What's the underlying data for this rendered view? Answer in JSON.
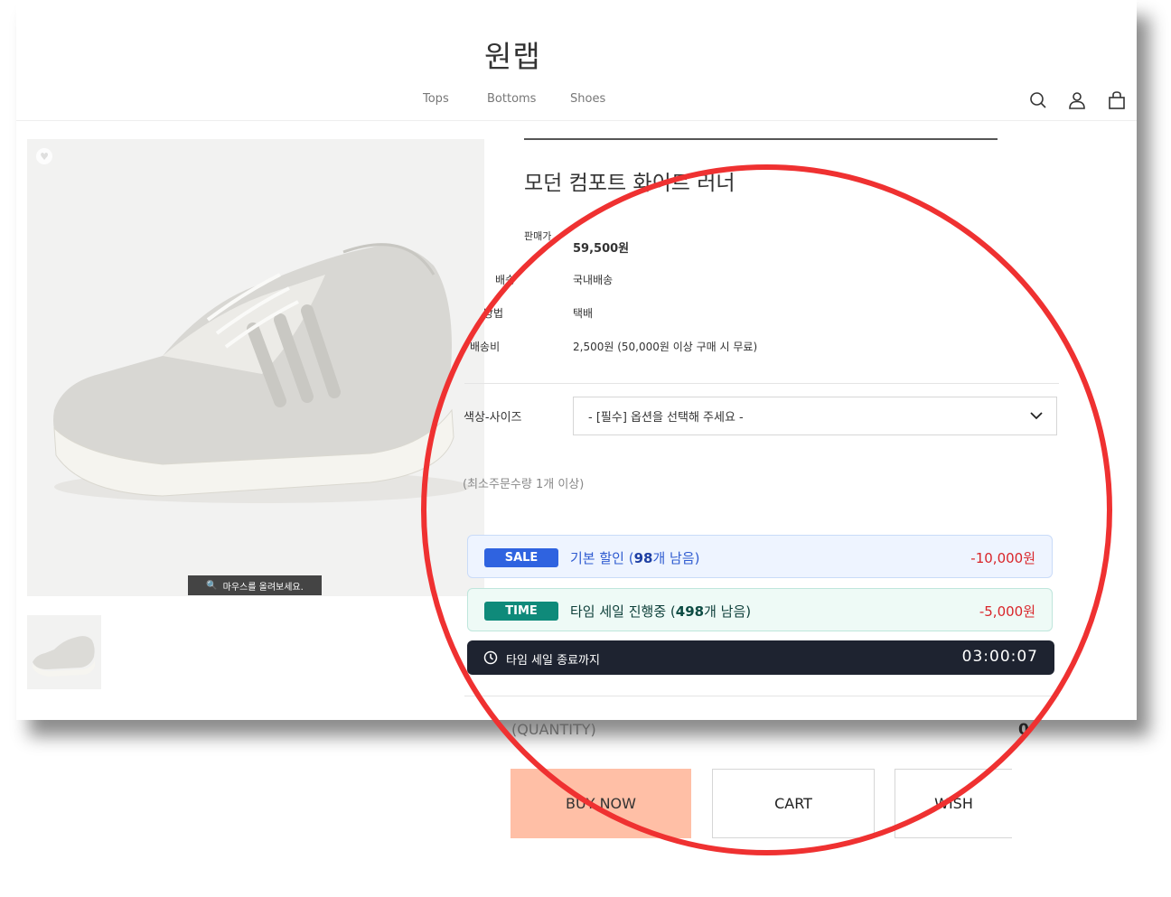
{
  "header": {
    "logo": "원랩",
    "nav": [
      "Tops",
      "Bottoms",
      "Shoes"
    ]
  },
  "gallery": {
    "zoom_hint": "마우스를 올려보세요."
  },
  "product": {
    "title": "모던 컴포트 화이트 러너",
    "info": [
      {
        "label": "판매가",
        "value": "59,500원"
      },
      {
        "label": "배송",
        "value": "국내배송"
      },
      {
        "label": "방법",
        "value": "택배"
      },
      {
        "label": "배송비",
        "value": "2,500원 (50,000원 이상 구매 시 무료)"
      }
    ],
    "option": {
      "label": "색상-사이즈",
      "placeholder": "- [필수] 옵션을 선택해 주세요 -"
    },
    "min_order": "(최소주문수량 1개 이상)"
  },
  "promos": [
    {
      "badge": "SALE",
      "text_pre": "기본 할인 (",
      "count": "98",
      "text_post": "개 남음)",
      "amount": "-10,000원",
      "badge_color": "#2f63e0",
      "bg": "#eef4ff",
      "border": "#c9dbf8",
      "count_color": "#1e3fa3"
    },
    {
      "badge": "TIME",
      "text_pre": "타임 세일 진행중 (",
      "count": "498",
      "text_post": "개 남음)",
      "amount": "-5,000원",
      "badge_color": "#0f8a7a",
      "bg": "#eefaf6",
      "border": "#bfe6dc",
      "count_color": "#0d4c43"
    }
  ],
  "timer": {
    "label": "타임 세일 종료까지",
    "time": "03:00:07"
  },
  "quantity": {
    "label": "(QUANTITY)",
    "value": "0"
  },
  "buttons": {
    "buy": "BUY NOW",
    "cart": "CART",
    "wish": "WISH"
  },
  "colors": {
    "annotation_circle": "#ef3131",
    "buy_bg": "#ffbfa6",
    "timer_bg": "#1e2330"
  }
}
